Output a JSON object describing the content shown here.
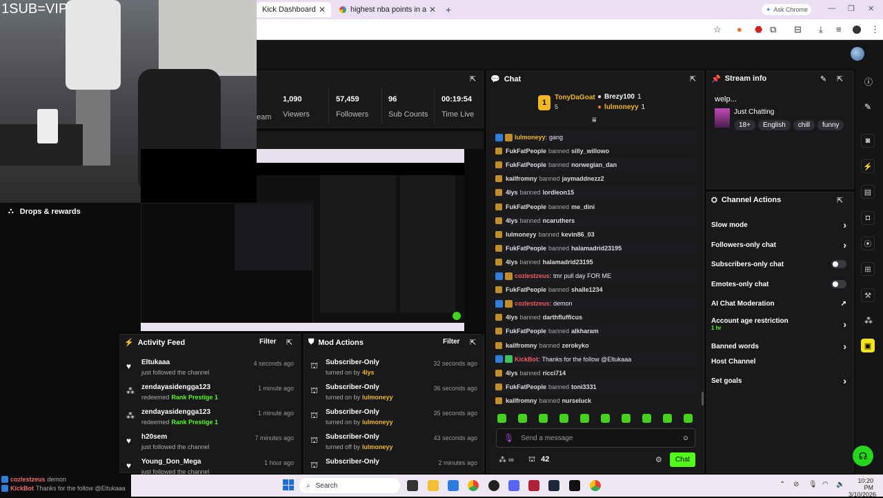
{
  "browser": {
    "tabs": [
      {
        "label": "Kick Dashboard"
      },
      {
        "label": "highest nba points in a game b"
      }
    ],
    "new_tab": "+",
    "ask_chrome": "Ask Chrome"
  },
  "overlay": {
    "title": "1SUB=VIP"
  },
  "stats": [
    {
      "value": "1,090",
      "label": "Viewers"
    },
    {
      "value": "57,459",
      "label": "Followers"
    },
    {
      "value": "96",
      "label": "Sub Counts"
    },
    {
      "value": "00:19:54",
      "label": "Time Live"
    }
  ],
  "stats_partial_label": "eam",
  "drops": {
    "label": "Drops & rewards"
  },
  "chat": {
    "title": "Chat",
    "leaderboard": [
      {
        "rank": "1",
        "name": "TonyDaGoat",
        "count": "5"
      },
      {
        "name": "Brezy100",
        "count": "1"
      },
      {
        "name": "lulmoneyy",
        "count": "1"
      }
    ],
    "messages": [
      {
        "user": "lulmoneyy",
        "text": "gang",
        "type": "msg"
      },
      {
        "user": "FukFatPeople",
        "action": "banned",
        "target": "silly_willowo"
      },
      {
        "user": "FukFatPeople",
        "action": "banned",
        "target": "norwegian_dan"
      },
      {
        "user": "kailfromny",
        "action": "banned",
        "target": "jaymaddnezz2"
      },
      {
        "user": "4lys",
        "action": "banned",
        "target": "lordleon15"
      },
      {
        "user": "FukFatPeople",
        "action": "banned",
        "target": "me_dini"
      },
      {
        "user": "4lys",
        "action": "banned",
        "target": "ncaruthers"
      },
      {
        "user": "lulmoneyy",
        "action": "banned",
        "target": "kevin86_03"
      },
      {
        "user": "FukFatPeople",
        "action": "banned",
        "target": "halamadrid23195"
      },
      {
        "user": "4lys",
        "action": "banned",
        "target": "halamadrid23195"
      },
      {
        "user": "cozlestzeus",
        "text": "tmr pull day FOR ME",
        "type": "msg"
      },
      {
        "user": "FukFatPeople",
        "action": "banned",
        "target": "shalle1234"
      },
      {
        "user": "cozlestzeus",
        "text": "demon",
        "type": "msg"
      },
      {
        "user": "4lys",
        "action": "banned",
        "target": "darthflufficus"
      },
      {
        "user": "FukFatPeople",
        "action": "banned",
        "target": "alkharam"
      },
      {
        "user": "kailfromny",
        "action": "banned",
        "target": "zerokyko"
      },
      {
        "user": "KickBot",
        "text": "Thanks for the follow @Eltukaaa",
        "type": "msg"
      },
      {
        "user": "4lys",
        "action": "banned",
        "target": "ricci714"
      },
      {
        "user": "FukFatPeople",
        "action": "banned",
        "target": "toni3331"
      },
      {
        "user": "kailfromny",
        "action": "banned",
        "target": "nurseluck"
      }
    ],
    "input_placeholder": "Send a message",
    "count_label": "42",
    "send_label": "Chat"
  },
  "stream_info": {
    "title": "Stream info",
    "stream_title": "welp...",
    "category": "Just Chatting",
    "tags": [
      "18+",
      "English",
      "chill",
      "funny"
    ]
  },
  "channel_actions": {
    "title": "Channel Actions",
    "items": [
      {
        "label": "Slow mode",
        "control": "chevron"
      },
      {
        "label": "Followers-only chat",
        "control": "chevron"
      },
      {
        "label": "Subscribers-only chat",
        "control": "toggle"
      },
      {
        "label": "Emotes-only chat",
        "control": "toggle"
      },
      {
        "label": "AI Chat Moderation",
        "control": "external"
      },
      {
        "label": "Account age restriction",
        "sub": "1 hr",
        "control": "chevron"
      },
      {
        "label": "Banned words",
        "control": "chevron"
      },
      {
        "label": "Host Channel",
        "control": "none"
      },
      {
        "label": "Set goals",
        "control": "chevron"
      }
    ]
  },
  "activity_feed": {
    "title": "Activity Feed",
    "filter": "Filter",
    "items": [
      {
        "name": "Eltukaaa",
        "desc": "just followed the channel",
        "time": "4 seconds ago"
      },
      {
        "name": "zendayasidengga123",
        "desc": "redeemed",
        "reward": "Rank Prestige 1",
        "time": "1 minute ago"
      },
      {
        "name": "zendayasidengga123",
        "desc": "redeemed",
        "reward": "Rank Prestige 1",
        "time": "1 minute ago"
      },
      {
        "name": "h20sem",
        "desc": "just followed the channel",
        "time": "7 minutes ago"
      },
      {
        "name": "Young_Don_Mega",
        "desc": "just followed the channel",
        "time": "1 hour ago"
      }
    ]
  },
  "mod_actions": {
    "title": "Mod Actions",
    "filter": "Filter",
    "items": [
      {
        "name": "Subscriber-Only",
        "desc": "turned on by",
        "by": "4lys",
        "time": "32 seconds ago"
      },
      {
        "name": "Subscriber-Only",
        "desc": "turned on by",
        "by": "lulmoneyy",
        "time": "36 seconds ago"
      },
      {
        "name": "Subscriber-Only",
        "desc": "turned on by",
        "by": "lulmoneyy",
        "time": "35 seconds ago"
      },
      {
        "name": "Subscriber-Only",
        "desc": "turned off by",
        "by": "lulmoneyy",
        "time": "43 seconds ago"
      },
      {
        "name": "Subscriber-Only",
        "desc": "",
        "by": "",
        "time": "2 minutes ago"
      }
    ]
  },
  "notifications": [
    {
      "user": "cozlestzeus",
      "text": "demon"
    },
    {
      "user": "KickBot",
      "text": "Thanks for the follow @Eltukaaa"
    }
  ],
  "taskbar": {
    "search": "Search",
    "time": "10:20 PM",
    "date": "3/10/2026"
  },
  "colors": {
    "accent": "#53fc18",
    "panel": "#19191c",
    "background": "#0b0b0c",
    "tabbar": "#eadff3"
  }
}
